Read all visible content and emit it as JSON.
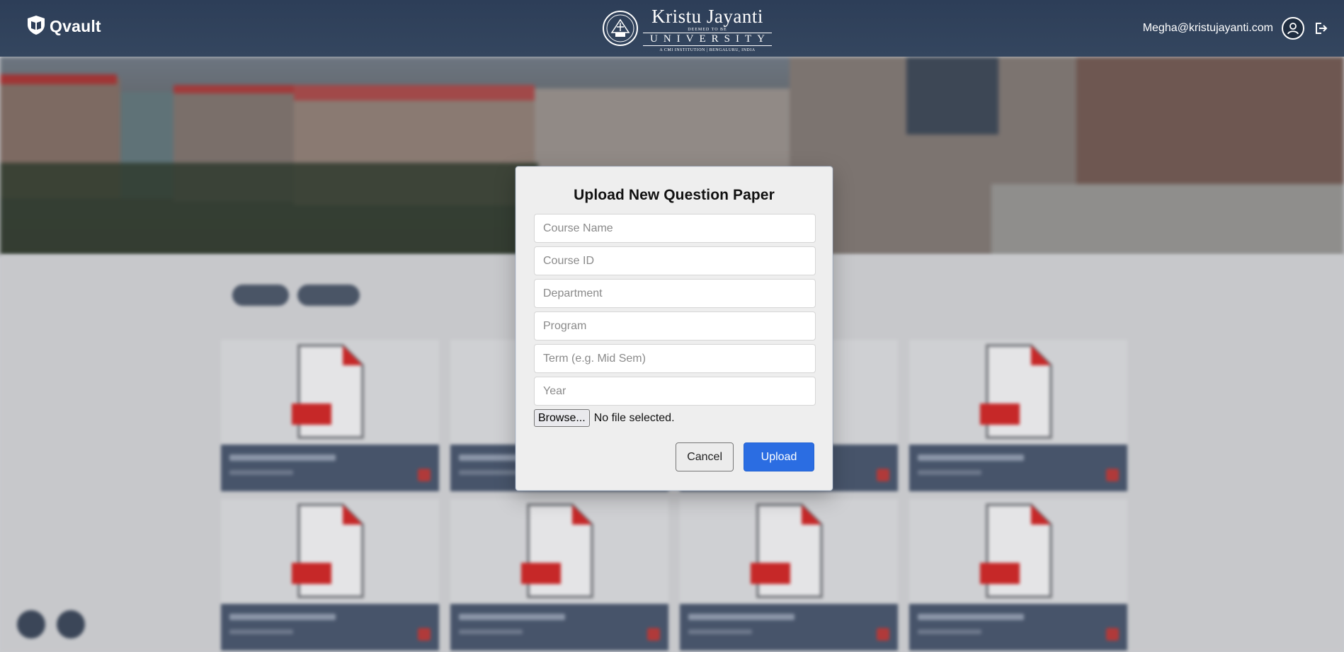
{
  "header": {
    "brand": "Qvault",
    "university": {
      "name": "Kristu Jayanti",
      "deemed": "DEEMED TO BE",
      "word": "UNIVERSITY",
      "subline": "A CMI INSTITUTION | BENGALURU, INDIA"
    },
    "user_email": "Megha@kristujayanti.com"
  },
  "modal": {
    "title": "Upload New Question Paper",
    "fields": {
      "course_name": "Course Name",
      "course_id": "Course ID",
      "department": "Department",
      "program": "Program",
      "term": "Term (e.g. Mid Sem)",
      "year": "Year"
    },
    "browse_label": "Browse...",
    "file_status": "No file selected.",
    "cancel_label": "Cancel",
    "upload_label": "Upload"
  },
  "colors": {
    "header_bg": "#2d3e58",
    "primary": "#2b6de2",
    "pdf_red": "#c62828"
  }
}
